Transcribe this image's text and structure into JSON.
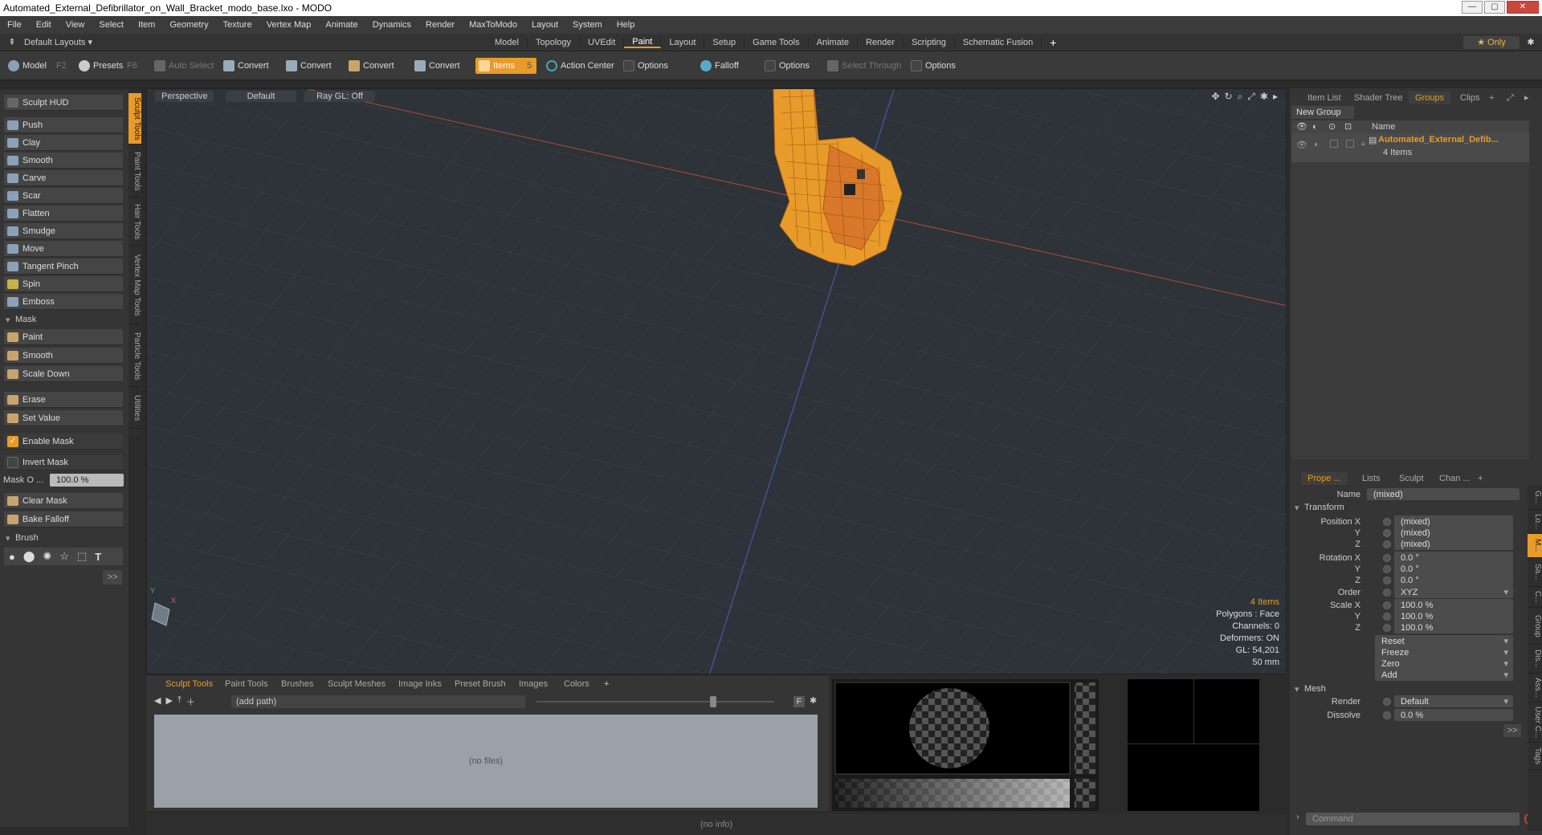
{
  "window": {
    "title": "Automated_External_Defibrillator_on_Wall_Bracket_modo_base.lxo - MODO"
  },
  "menu": [
    "File",
    "Edit",
    "View",
    "Select",
    "Item",
    "Geometry",
    "Texture",
    "Vertex Map",
    "Animate",
    "Dynamics",
    "Render",
    "MaxToModo",
    "Layout",
    "System",
    "Help"
  ],
  "layoutbar": {
    "layouts_label": "Default Layouts ▾",
    "tabs": [
      "Model",
      "Topology",
      "UVEdit",
      "Paint",
      "Layout",
      "Setup",
      "Game Tools",
      "Animate",
      "Render",
      "Scripting",
      "Schematic Fusion"
    ],
    "active_tab": "Paint",
    "plus": "+",
    "only_label": "★ Only",
    "gear": "✱"
  },
  "toolbar": {
    "model": "Model",
    "model_key": "F2",
    "presets": "Presets",
    "presets_key": "F6",
    "auto_select": "Auto Select",
    "convert1": "Convert",
    "convert2": "Convert",
    "convert3": "Convert",
    "convert4": "Convert",
    "items": "Items",
    "items_key": "5",
    "action_center": "Action Center",
    "options1": "Options",
    "falloff": "Falloff",
    "options2": "Options",
    "select_through": "Select Through",
    "options3": "Options"
  },
  "sidebar": {
    "hud": "Sculpt HUD",
    "tools": [
      "Push",
      "Clay",
      "Smooth",
      "Carve",
      "Scar",
      "Flatten",
      "Smudge",
      "Move",
      "Tangent Pinch",
      "Spin",
      "Emboss"
    ],
    "mask_header": "Mask",
    "mask_tools": [
      "Paint",
      "Smooth",
      "Scale Down"
    ],
    "erase": "Erase",
    "set_value": "Set Value",
    "enable_mask": "Enable Mask",
    "invert_mask": "Invert Mask",
    "mask_opacity_label": "Mask O ...",
    "mask_opacity_value": "100.0 %",
    "clear_mask": "Clear Mask",
    "bake_falloff": "Bake Falloff",
    "brush_header": "Brush",
    "more": ">>",
    "text_tool": "T"
  },
  "vtabs": [
    "Sculpt Tools",
    "Paint Tools",
    "Hair Tools",
    "Vertex Map Tools",
    "Particle Tools",
    "Utilities"
  ],
  "viewport": {
    "view": "Perspective",
    "shading": "Default",
    "raygl": "Ray GL: Off",
    "info": {
      "items": "4 Items",
      "polygons": "Polygons : Face",
      "channels": "Channels: 0",
      "deformers": "Deformers: ON",
      "gl": "GL: 54,201",
      "scale": "50 mm"
    }
  },
  "bottom": {
    "tabs": [
      "Sculpt Tools",
      "Paint Tools",
      "Brushes",
      "Sculpt Meshes",
      "Image Inks",
      "Preset Brush",
      "Images",
      "Colors"
    ],
    "plus": "+",
    "path": "(add path)",
    "nofiles": "(no files)",
    "f": "F"
  },
  "status": "(no info)",
  "right": {
    "tabs": [
      "Item List",
      "Shader Tree",
      "Groups",
      "Clips"
    ],
    "active_tab": "Groups",
    "plus": "+",
    "new_group": "New Group",
    "col_name": "Name",
    "group_name": "Automated_External_Defib...",
    "group_count": "4 Items",
    "prop_tabs": [
      "Prope ...",
      "Lists",
      "Sculpt",
      "Chan ..."
    ],
    "prop_plus": "+",
    "name_label": "Name",
    "name_value": "(mixed)",
    "transform": "Transform",
    "pos_label": "Position X",
    "pos": [
      "(mixed)",
      "(mixed)",
      "(mixed)"
    ],
    "rot_label": "Rotation X",
    "rot": [
      "0.0 °",
      "0.0 °",
      "0.0 °"
    ],
    "order_label": "Order",
    "order": "XYZ",
    "scale_label": "Scale X",
    "scale": [
      "100.0 %",
      "100.0 %",
      "100.0 %"
    ],
    "y": "Y",
    "z": "Z",
    "actions": [
      "Reset",
      "Freeze",
      "Zero",
      "Add"
    ],
    "mesh": "Mesh",
    "render_label": "Render",
    "render_value": "Default",
    "dissolve_label": "Dissolve",
    "dissolve_value": "0.0 %",
    "more": ">>",
    "command_placeholder": "Command",
    "rvtabs": [
      "G...",
      "Lo...",
      "M...",
      "Sa...",
      "C...",
      "Group",
      "Dis...",
      "Ass...",
      "User C...",
      "Tags"
    ]
  }
}
